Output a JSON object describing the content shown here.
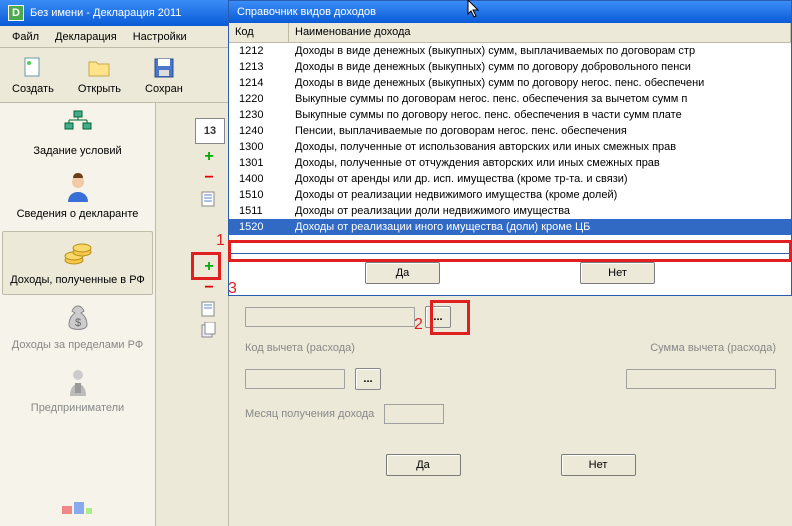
{
  "window": {
    "title": "Без имени - Декларация 2011",
    "app_icon_letter": "D"
  },
  "menu": {
    "file": "Файл",
    "declaration": "Декларация",
    "settings": "Настройки"
  },
  "toolbar": {
    "create": "Создать",
    "open": "Открыть",
    "save": "Сохран"
  },
  "sidebar": {
    "items": [
      {
        "label": "Задание условий"
      },
      {
        "label": "Сведения о декларанте"
      },
      {
        "label": "Доходы, полученные в РФ"
      },
      {
        "label": "Доходы за пределами РФ"
      },
      {
        "label": "Предприниматели"
      }
    ]
  },
  "calc_label": "13",
  "dialog": {
    "title": "Справочник видов доходов",
    "columns": {
      "code": "Код",
      "name": "Наименование дохода"
    },
    "rows": [
      {
        "code": "1212",
        "name": "Доходы в виде денежных (выкупных) сумм, выплачиваемых по договорам стр"
      },
      {
        "code": "1213",
        "name": "Доходы в виде денежных (выкупных) сумм по договору добровольного пенси"
      },
      {
        "code": "1214",
        "name": "Доходы в виде денежных (выкупных) сумм по договору негос. пенс. обеспечени"
      },
      {
        "code": "1220",
        "name": "Выкупные суммы по договорам негос. пенс. обеспечения за вычетом сумм п"
      },
      {
        "code": "1230",
        "name": "Выкупные суммы по договору негос. пенс. обеспечения в части сумм плате"
      },
      {
        "code": "1240",
        "name": "Пенсии, выплачиваемые по договорам негос. пенс. обеспечения"
      },
      {
        "code": "1300",
        "name": "Доходы, полученные от использования авторских или иных смежных прав"
      },
      {
        "code": "1301",
        "name": "Доходы, полученные от отчуждения авторских или иных смежных прав"
      },
      {
        "code": "1400",
        "name": "Доходы от аренды или др. исп. имущества (кроме тр-та. и связи)"
      },
      {
        "code": "1510",
        "name": "Доходы от реализации недвижимого имущества (кроме долей)"
      },
      {
        "code": "1511",
        "name": "Доходы от реализации доли недвижимого имущества"
      },
      {
        "code": "1520",
        "name": "Доходы от реализации иного имущества (доли) кроме ЦБ",
        "selected": true
      }
    ],
    "buttons": {
      "yes": "Да",
      "no": "Нет"
    }
  },
  "lower_form": {
    "code_deduction": "Код вычета (расхода)",
    "sum_deduction": "Сумма вычета (расхода)",
    "month": "Месяц получения дохода",
    "ellipsis": "...",
    "yes": "Да",
    "no": "Нет"
  },
  "annotations": {
    "one": "1",
    "two": "2",
    "three": "3"
  }
}
